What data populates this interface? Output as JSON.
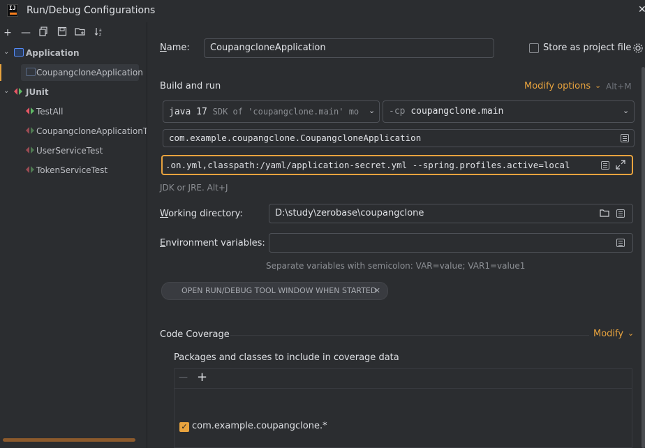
{
  "window": {
    "title": "Run/Debug Configurations",
    "logo_text": "IJ"
  },
  "toolbar": {
    "icons": [
      "add-icon",
      "remove-icon",
      "copy-icon",
      "save-icon",
      "new-folder-icon",
      "sort-icon"
    ]
  },
  "tree": {
    "groups": [
      {
        "label": "Application",
        "children": [
          {
            "label": "CoupangcloneApplication",
            "selected": true
          }
        ]
      },
      {
        "label": "JUnit",
        "children": [
          {
            "label": "TestAll"
          },
          {
            "label": "CoupangcloneApplicationTests"
          },
          {
            "label": "UserServiceTest"
          },
          {
            "label": "TokenServiceTest"
          }
        ]
      }
    ]
  },
  "form": {
    "name_label": "Name:",
    "name_value": "CoupangcloneApplication",
    "store_label": "Store as project file",
    "build_run_label": "Build and run",
    "modify_options": "Modify options",
    "modify_shortcut": "Alt+M",
    "jre_main": "java 17",
    "jre_sdk": "SDK of 'coupangclone.main' mo",
    "cp_flag": "-cp",
    "cp_value": "coupangclone.main",
    "main_class": "com.example.coupangclone.CoupangcloneApplication",
    "program_args": ".on.yml,classpath:/yaml/application-secret.yml --spring.profiles.active=local",
    "jre_hint": "JDK or JRE. Alt+J",
    "workdir_label": "Working directory:",
    "workdir_value": "D:\\study\\zerobase\\coupangclone",
    "env_label": "Environment variables:",
    "env_value": "",
    "env_hint": "Separate variables with semicolon: VAR=value; VAR1=value1",
    "chip_label": "OPEN RUN/DEBUG TOOL WINDOW WHEN STARTED",
    "coverage_label": "Code Coverage",
    "coverage_modify": "Modify",
    "packages_label": "Packages and classes to include in coverage data",
    "packages": [
      {
        "label": "com.example.coupangclone.*",
        "checked": true
      }
    ]
  },
  "colors": {
    "accent": "#e8a33e",
    "background": "#2b2d30"
  }
}
